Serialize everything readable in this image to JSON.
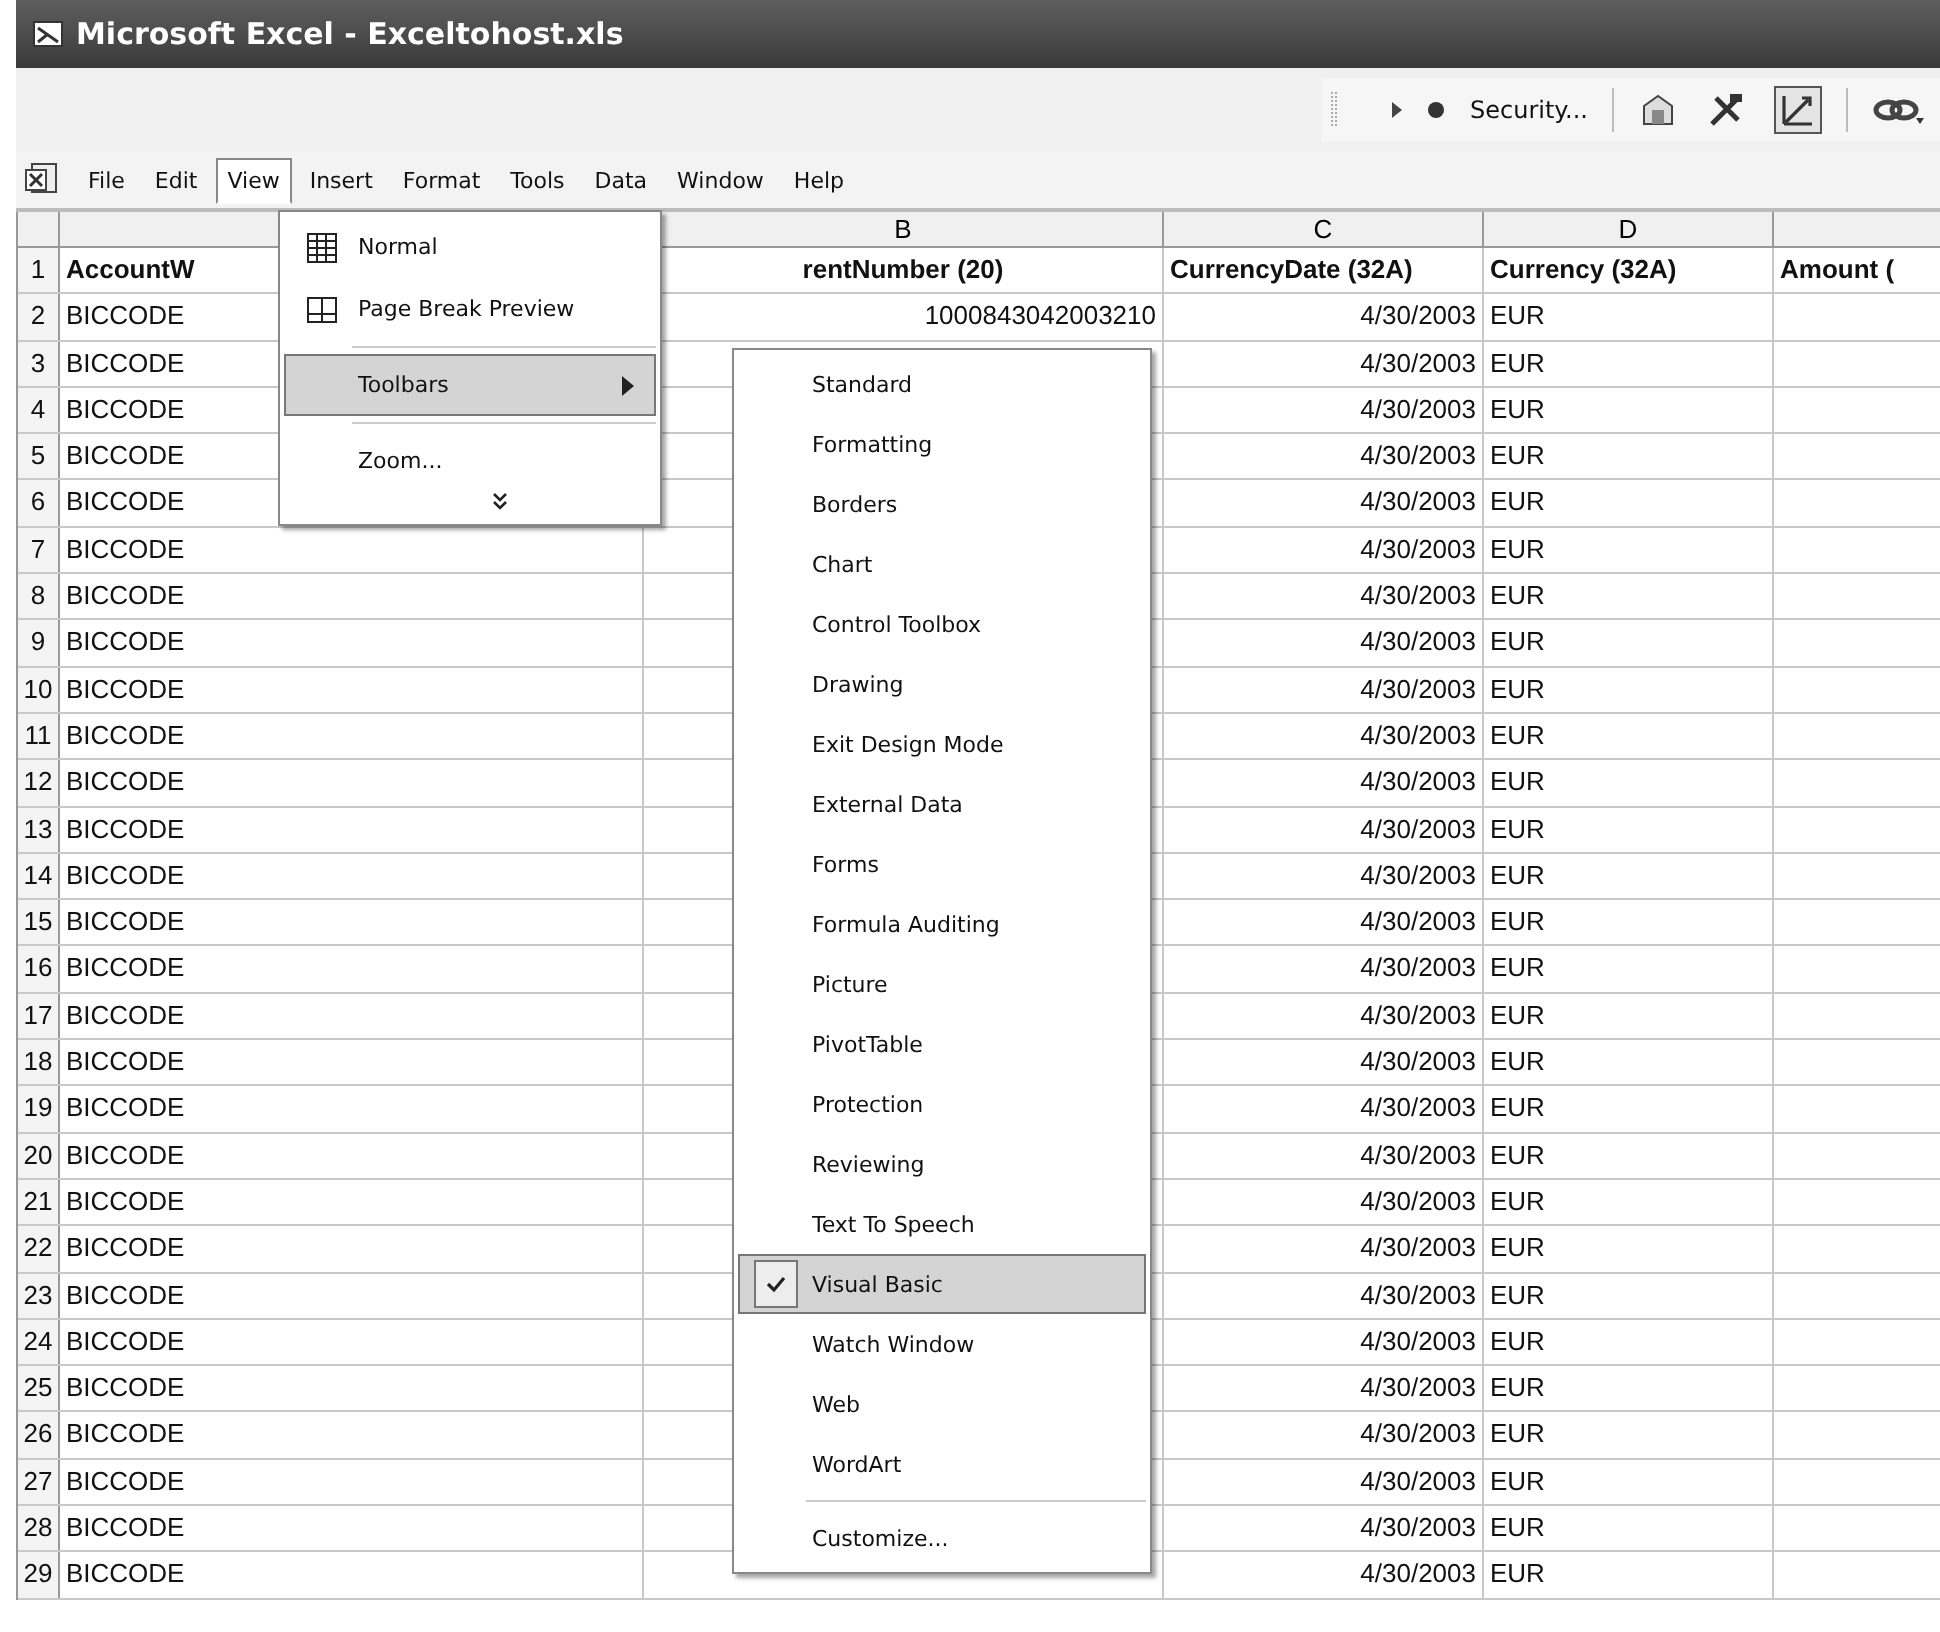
{
  "window": {
    "title": "Microsoft Excel - Exceltohost.xls"
  },
  "toolbar": {
    "security": "Security...",
    "design_mode_on": true
  },
  "menu_bar": [
    {
      "label": "File",
      "selected": false
    },
    {
      "label": "Edit",
      "selected": false
    },
    {
      "label": "View",
      "selected": true
    },
    {
      "label": "Insert",
      "selected": false
    },
    {
      "label": "Format",
      "selected": false
    },
    {
      "label": "Tools",
      "selected": false
    },
    {
      "label": "Data",
      "selected": false
    },
    {
      "label": "Window",
      "selected": false
    },
    {
      "label": "Help",
      "selected": false
    }
  ],
  "sheet": {
    "column_headers": {
      "column_2": "B",
      "column_3": "C",
      "column_4": "D"
    },
    "rows": [
      {
        "number": "1",
        "kind": "header",
        "cells": {
          "column_1": "AccountW",
          "column_2": "rentNumber (20)",
          "column_3": "CurrencyDate (32A)",
          "column_4": "Currency (32A)",
          "column_5": "Amount ("
        }
      },
      {
        "number": "2",
        "kind": "data",
        "cells": {
          "column_1": "BICCODE",
          "column_2": "1000843042003210",
          "column_3": "4/30/2003",
          "column_4": "EUR"
        }
      },
      {
        "number": "3",
        "kind": "data",
        "cells": {
          "column_1": "BICCODE",
          "column_3": "4/30/2003",
          "column_4": "EUR"
        }
      },
      {
        "number": "4",
        "kind": "data",
        "cells": {
          "column_1": "BICCODE",
          "column_3": "4/30/2003",
          "column_4": "EUR"
        }
      },
      {
        "number": "5",
        "kind": "data",
        "cells": {
          "column_1": "BICCODE",
          "column_3": "4/30/2003",
          "column_4": "EUR"
        }
      },
      {
        "number": "6",
        "kind": "data",
        "cells": {
          "column_1": "BICCODE",
          "column_3": "4/30/2003",
          "column_4": "EUR"
        }
      },
      {
        "number": "7",
        "kind": "data",
        "cells": {
          "column_1": "BICCODE",
          "column_3": "4/30/2003",
          "column_4": "EUR"
        }
      },
      {
        "number": "8",
        "kind": "data",
        "cells": {
          "column_1": "BICCODE",
          "column_3": "4/30/2003",
          "column_4": "EUR"
        }
      },
      {
        "number": "9",
        "kind": "data",
        "cells": {
          "column_1": "BICCODE",
          "column_3": "4/30/2003",
          "column_4": "EUR"
        }
      },
      {
        "number": "10",
        "kind": "data",
        "cells": {
          "column_1": "BICCODE",
          "column_3": "4/30/2003",
          "column_4": "EUR"
        }
      },
      {
        "number": "11",
        "kind": "data",
        "cells": {
          "column_1": "BICCODE",
          "column_3": "4/30/2003",
          "column_4": "EUR"
        }
      },
      {
        "number": "12",
        "kind": "data",
        "cells": {
          "column_1": "BICCODE",
          "column_3": "4/30/2003",
          "column_4": "EUR"
        }
      },
      {
        "number": "13",
        "kind": "data",
        "cells": {
          "column_1": "BICCODE",
          "column_3": "4/30/2003",
          "column_4": "EUR"
        }
      },
      {
        "number": "14",
        "kind": "data",
        "cells": {
          "column_1": "BICCODE",
          "column_3": "4/30/2003",
          "column_4": "EUR"
        }
      },
      {
        "number": "15",
        "kind": "data",
        "cells": {
          "column_1": "BICCODE",
          "column_3": "4/30/2003",
          "column_4": "EUR"
        }
      },
      {
        "number": "16",
        "kind": "data",
        "cells": {
          "column_1": "BICCODE",
          "column_3": "4/30/2003",
          "column_4": "EUR"
        }
      },
      {
        "number": "17",
        "kind": "data",
        "cells": {
          "column_1": "BICCODE",
          "column_3": "4/30/2003",
          "column_4": "EUR"
        }
      },
      {
        "number": "18",
        "kind": "data",
        "cells": {
          "column_1": "BICCODE",
          "column_3": "4/30/2003",
          "column_4": "EUR"
        }
      },
      {
        "number": "19",
        "kind": "data",
        "cells": {
          "column_1": "BICCODE",
          "column_3": "4/30/2003",
          "column_4": "EUR"
        }
      },
      {
        "number": "20",
        "kind": "data",
        "cells": {
          "column_1": "BICCODE",
          "column_3": "4/30/2003",
          "column_4": "EUR"
        }
      },
      {
        "number": "21",
        "kind": "data",
        "cells": {
          "column_1": "BICCODE",
          "column_3": "4/30/2003",
          "column_4": "EUR"
        }
      },
      {
        "number": "22",
        "kind": "data",
        "cells": {
          "column_1": "BICCODE",
          "column_3": "4/30/2003",
          "column_4": "EUR"
        }
      },
      {
        "number": "23",
        "kind": "data",
        "cells": {
          "column_1": "BICCODE",
          "column_3": "4/30/2003",
          "column_4": "EUR"
        }
      },
      {
        "number": "24",
        "kind": "data",
        "cells": {
          "column_1": "BICCODE",
          "column_3": "4/30/2003",
          "column_4": "EUR"
        }
      },
      {
        "number": "25",
        "kind": "data",
        "cells": {
          "column_1": "BICCODE",
          "column_3": "4/30/2003",
          "column_4": "EUR"
        }
      },
      {
        "number": "26",
        "kind": "data",
        "cells": {
          "column_1": "BICCODE",
          "column_3": "4/30/2003",
          "column_4": "EUR"
        }
      },
      {
        "number": "27",
        "kind": "data",
        "cells": {
          "column_1": "BICCODE",
          "column_3": "4/30/2003",
          "column_4": "EUR"
        }
      },
      {
        "number": "28",
        "kind": "data",
        "cells": {
          "column_1": "BICCODE",
          "column_3": "4/30/2003",
          "column_4": "EUR"
        }
      },
      {
        "number": "29",
        "kind": "data",
        "cells": {
          "column_1": "BICCODE",
          "column_3": "4/30/2003",
          "column_4": "EUR"
        }
      }
    ]
  },
  "view_menu": {
    "items": [
      {
        "kind": "item",
        "label": "Normal",
        "selected": false
      },
      {
        "kind": "item",
        "label": "Page Break Preview",
        "selected": false
      },
      {
        "kind": "separator"
      },
      {
        "kind": "submenu",
        "label": "Toolbars",
        "selected": true
      },
      {
        "kind": "separator"
      },
      {
        "kind": "item",
        "label": "Zoom...",
        "selected": false
      },
      {
        "kind": "expand"
      }
    ]
  },
  "toolbars_submenu": {
    "items": [
      {
        "label": "Standard",
        "checked": false,
        "selected": false
      },
      {
        "label": "Formatting",
        "checked": false,
        "selected": false
      },
      {
        "label": "Borders",
        "checked": false,
        "selected": false
      },
      {
        "label": "Chart",
        "checked": false,
        "selected": false
      },
      {
        "label": "Control Toolbox",
        "checked": false,
        "selected": false
      },
      {
        "label": "Drawing",
        "checked": false,
        "selected": false
      },
      {
        "label": "Exit Design Mode",
        "checked": false,
        "selected": false
      },
      {
        "label": "External Data",
        "checked": false,
        "selected": false
      },
      {
        "label": "Forms",
        "checked": false,
        "selected": false
      },
      {
        "label": "Formula Auditing",
        "checked": false,
        "selected": false
      },
      {
        "label": "Picture",
        "checked": false,
        "selected": false
      },
      {
        "label": "PivotTable",
        "checked": false,
        "selected": false
      },
      {
        "label": "Protection",
        "checked": false,
        "selected": false
      },
      {
        "label": "Reviewing",
        "checked": false,
        "selected": false
      },
      {
        "label": "Text To Speech",
        "checked": false,
        "selected": false
      },
      {
        "label": "Visual Basic",
        "checked": true,
        "selected": true
      },
      {
        "label": "Watch Window",
        "checked": false,
        "selected": false
      },
      {
        "label": "Web",
        "checked": false,
        "selected": false
      },
      {
        "label": "WordArt",
        "checked": false,
        "selected": false
      },
      {
        "kind": "separator"
      },
      {
        "label": "Customize...",
        "checked": false,
        "selected": false
      }
    ]
  }
}
